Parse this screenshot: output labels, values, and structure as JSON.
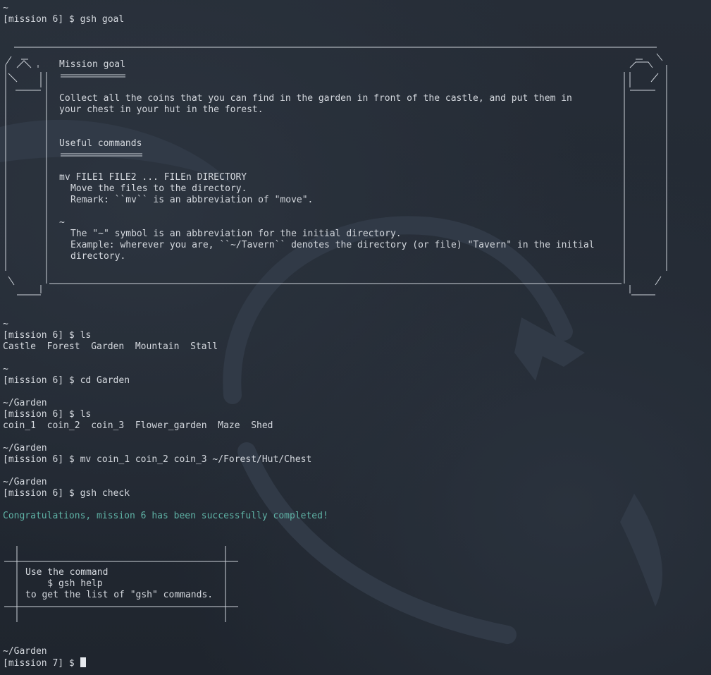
{
  "colors": {
    "background": "#232a34",
    "text": "#d4d8de",
    "success": "#5fb3a6"
  },
  "terminal": {
    "tilde": "~",
    "garden_dir": "~/Garden",
    "prompt_m6": "[mission 6] $ ",
    "prompt_m7": "[mission 7] $ ",
    "cmd_goal": "gsh goal",
    "cmd_ls": "ls",
    "cmd_cd": "cd Garden",
    "cmd_mv": "mv coin_1 coin_2 coin_3 ~/Forest/Hut/Chest",
    "cmd_check": "gsh check",
    "ls_home": "Castle  Forest  Garden  Mountain  Stall",
    "ls_garden": "coin_1  coin_2  coin_3  Flower_garden  Maze  Shed",
    "success_message": "Congratulations, mission 6 has been successfully completed!"
  },
  "scroll": {
    "title": "Mission goal",
    "goal_line1": "Collect all the coins that you can find in the garden in front of the castle, and put them in",
    "goal_line2": "your chest in your hut in the forest.",
    "commands_title": "Useful commands",
    "mv_syntax": "mv FILE1 FILE2 ... FILEn DIRECTORY",
    "mv_desc": "Move the files to the directory.",
    "mv_remark": "Remark: ``mv`` is an abbreviation of \"move\".",
    "tilde_syntax": "~",
    "tilde_desc": "The \"~\" symbol is an abbreviation for the initial directory.",
    "tilde_example1": "Example: wherever you are, ``~/Tavern`` denotes the directory (or file) \"Tavern\" in the initial",
    "tilde_example2": "directory."
  },
  "help_box": {
    "line1": "Use the command",
    "line2": "    $ gsh help",
    "line3": "to get the list of \"gsh\" commands."
  }
}
